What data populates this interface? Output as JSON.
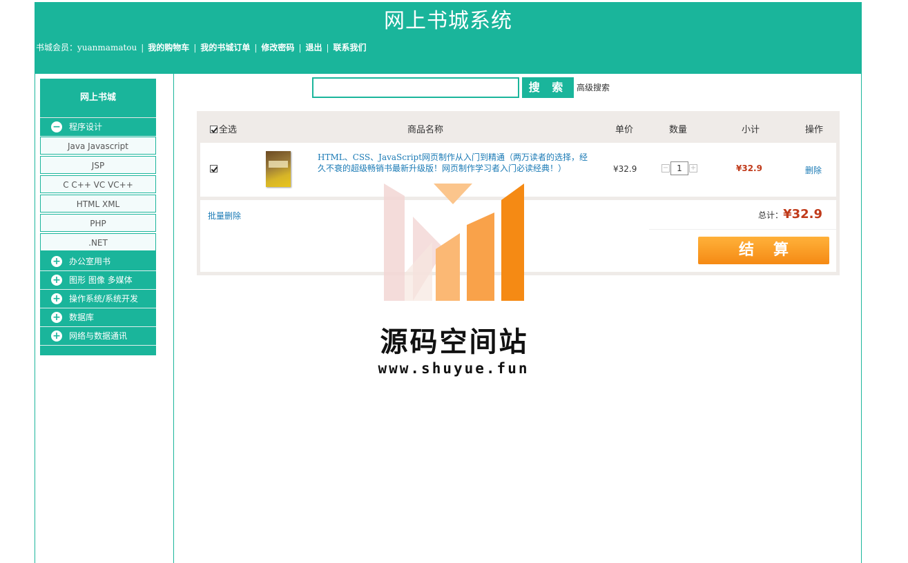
{
  "header": {
    "site_title": "网上书城系统",
    "member_label": "书城会员：",
    "username": "yuanmamatou",
    "links": [
      "我的购物车",
      "我的书城订单",
      "修改密码",
      "退出",
      "联系我们"
    ],
    "separator": "|"
  },
  "sidebar": {
    "title": "网上书城",
    "categories": [
      {
        "label": "程序设计",
        "icon": "minus-circle-icon",
        "expanded": true,
        "subs": [
          "Java Javascript",
          "JSP",
          "C C++ VC VC++",
          "HTML XML",
          "PHP",
          ".NET"
        ]
      },
      {
        "label": "办公室用书",
        "icon": "plus-circle-icon"
      },
      {
        "label": "图形 图像 多媒体",
        "icon": "plus-circle-icon"
      },
      {
        "label": "操作系统/系统开发",
        "icon": "plus-circle-icon"
      },
      {
        "label": "数据库",
        "icon": "plus-circle-icon"
      },
      {
        "label": "网络与数据通讯",
        "icon": "plus-circle-icon"
      }
    ]
  },
  "search": {
    "button_label": "搜 索",
    "advanced_label": "高级搜索",
    "value": ""
  },
  "cart": {
    "headers": {
      "select_all": "全选",
      "name": "商品名称",
      "unit_price": "单价",
      "quantity": "数量",
      "subtotal": "小计",
      "action": "操作"
    },
    "items": [
      {
        "checked": true,
        "title": "HTML、CSS、JavaScript网页制作从入门到精通（两万读者的选择，经久不衰的超级畅销书最新升级版！网页制作学习者入门必读经典！）",
        "price": "¥32.9",
        "quantity": "1",
        "subtotal": "¥32.9",
        "delete_label": "删除"
      }
    ],
    "batch_delete_label": "批量删除",
    "total_label": "总计：",
    "total_amount": "¥32.9",
    "checkout_label": "结算"
  },
  "watermark": {
    "name": "源码空间站",
    "url": "www.shuyue.fun"
  },
  "colors": {
    "brand": "#1ab59b",
    "price_red": "#c03a1a",
    "link_blue": "#1a7ab5",
    "checkout_orange": "#f58a14"
  }
}
